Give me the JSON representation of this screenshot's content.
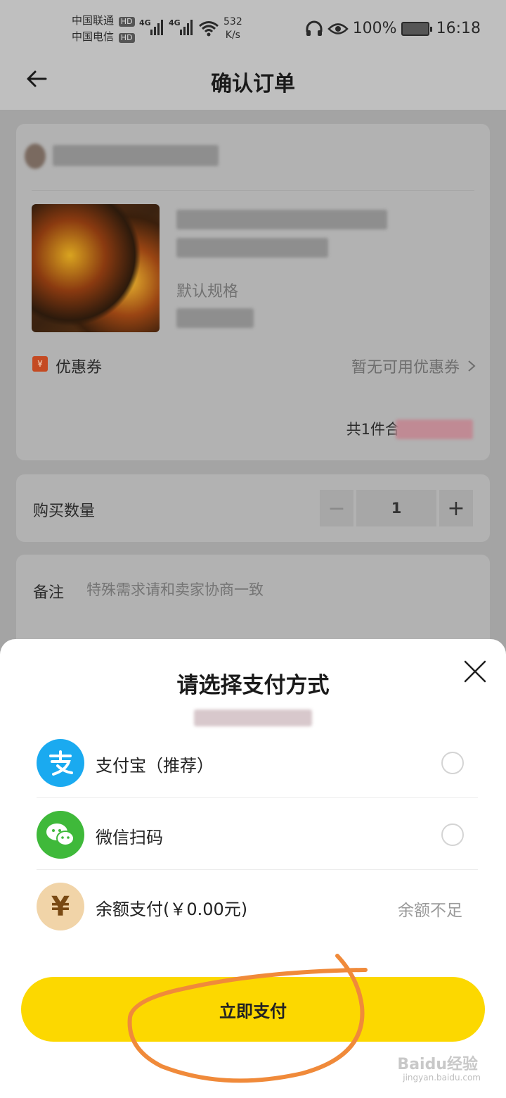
{
  "status_bar": {
    "carrier1": "中国联通",
    "carrier2": "中国电信",
    "hd_badge": "HD",
    "network1": "4G",
    "network2": "4G",
    "speed_value": "532",
    "speed_unit": "K/s",
    "battery": "100%",
    "time": "16:18"
  },
  "header": {
    "title": "确认订单"
  },
  "order": {
    "spec": "默认规格",
    "coupon_label": "优惠券",
    "coupon_icon_text": "¥",
    "coupon_status": "暂无可用优惠券",
    "total_prefix": "共1件合"
  },
  "quantity": {
    "label": "购买数量",
    "minus": "−",
    "value": "1",
    "plus": "+"
  },
  "note": {
    "label": "备注",
    "placeholder": "特殊需求请和卖家协商一致"
  },
  "payment_sheet": {
    "title": "请选择支付方式",
    "methods": [
      {
        "label": "支付宝（推荐）",
        "icon": "alipay-icon",
        "color": "#1aaaf0"
      },
      {
        "label": "微信扫码",
        "icon": "wechat-icon",
        "color": "#3fb93a"
      },
      {
        "label": "余额支付(￥0.00元)",
        "icon": "yuan-icon",
        "color": "#f1d4a8",
        "note": "余额不足"
      }
    ],
    "pay_button": "立即支付"
  },
  "watermark": {
    "brand": "Baidu经验",
    "url": "jingyan.baidu.com"
  },
  "colors": {
    "accent": "#fcd800",
    "annotation": "#f08a3a"
  }
}
